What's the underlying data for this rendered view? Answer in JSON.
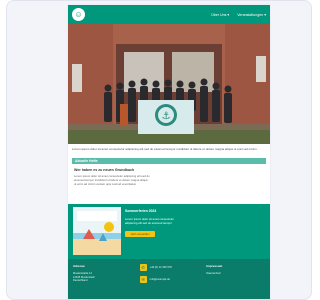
{
  "colors": {
    "brand": "#00987d",
    "brand_dark": "#0a7c69",
    "section_bar": "#5bbcaa",
    "accent": "#f2c312"
  },
  "header": {
    "logo_icon": "circle-logo-icon",
    "logo_glyph": "☺",
    "nav": [
      "Über Uns ▾",
      "Veranstaltungen ▾"
    ]
  },
  "photo": {
    "banner_glyph": "⚓"
  },
  "intro": {
    "text": "Lorem ipsum dolor sit amet consectetur adipiscing elit sed do eiusmod tempor incididunt ut labore et dolore magna aliqua ut enim ad minim."
  },
  "section": {
    "title": "Aktuelle Hefte"
  },
  "news": {
    "heading": "Wer haben es zu neuen Grundbuch",
    "lines": [
      "Lorem ipsum dolor sit amet consectetur adipiscing elit sed do",
      "eiusmod tempor incididunt ut labore et dolore magna aliqua",
      "ut enim ad minim veniam quis nostrud exercitation"
    ]
  },
  "promo": {
    "title": "Sommerferien 2023",
    "lines": [
      "Lorem ipsum dolor sit amet consectetur",
      "adipiscing elit sed do eiusmod tempor"
    ],
    "button": "Jetzt anmelden"
  },
  "footer": {
    "col1": {
      "title": "Adresse",
      "lines": [
        "Musterstraße 12",
        "12345 Musterstadt",
        "Deutschland"
      ]
    },
    "col2": {
      "items": [
        {
          "icon": "phone-icon",
          "glyph": "✆",
          "text": "+49 (0) 12 345 678"
        },
        {
          "icon": "mail-icon",
          "glyph": "✉",
          "text": "info@example.de"
        }
      ]
    },
    "col3": {
      "title": "Impressum",
      "lines": [
        "Datenschutz"
      ]
    }
  }
}
